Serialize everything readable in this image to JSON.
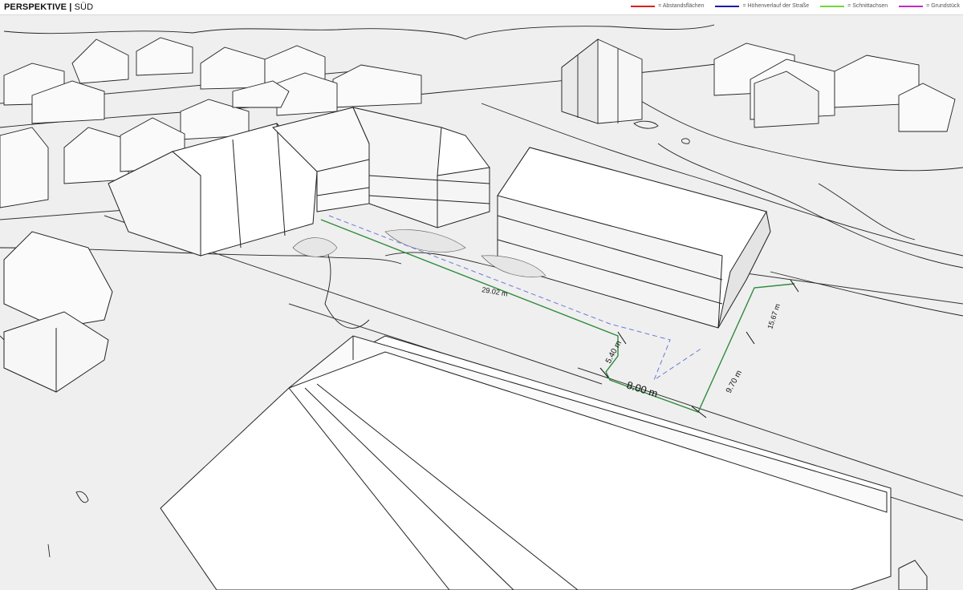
{
  "header": {
    "title_bold": "PERSPEKTIVE",
    "separator": "|",
    "title_rest": "SÜD"
  },
  "legend": [
    {
      "label": "= Abstandsflächen",
      "color": "#d62020"
    },
    {
      "label": "= Höhenverlauf der Straße",
      "color": "#1a1aa8"
    },
    {
      "label": "= Schnittachsen",
      "color": "#6fd83a"
    },
    {
      "label": "= Grundstück",
      "color": "#c22ac9"
    }
  ],
  "dimensions": {
    "d1": "29.02 m",
    "d2": "5.40 m",
    "d3": "8.00 m",
    "d4": "9.70 m",
    "d5": "15.67 m"
  },
  "colors": {
    "roof": "#ffffff",
    "wall_light": "#f4f4f4",
    "wall_dark": "#e2e2e2",
    "ground": "#efefef",
    "site_line": "#2e8b3e",
    "setback_dash": "#6a7bd6"
  }
}
